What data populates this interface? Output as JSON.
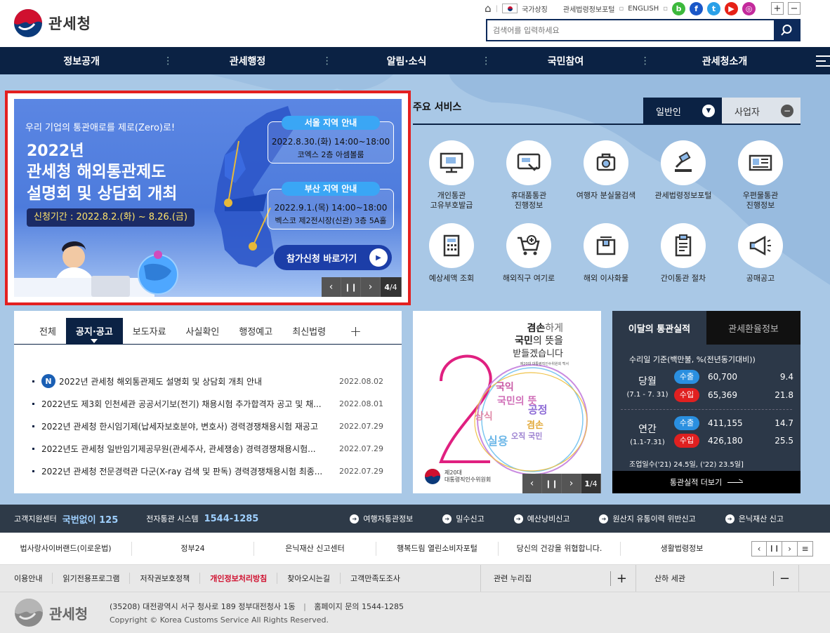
{
  "header": {
    "logo_text": "관세청",
    "util": {
      "home": "home-icon",
      "flag_label": "국가상징",
      "portal_label": "관세법령정보포털",
      "english_label": "ENGLISH",
      "sns": [
        "blog",
        "facebook",
        "twitter",
        "youtube",
        "instagram"
      ],
      "zoom_in": "+",
      "zoom_out": "−"
    },
    "search_placeholder": "검색어를 입력하세요"
  },
  "gnb": [
    "정보공개",
    "관세행정",
    "알림·소식",
    "국민참여",
    "관세청소개"
  ],
  "banner": {
    "tagline": "우리 기업의 통관애로를 제로(Zero)로!",
    "year": "2022년",
    "title_line1": "관세청 해외통관제도",
    "title_line2": "설명회 및 상담회 개최",
    "period": "신청기간 : 2022.8.2.(화) ~ 8.26.(금)",
    "seoul_label": "서울 지역 안내",
    "seoul_date": "2022.8.30.(화) 14:00~18:00",
    "seoul_place": "코엑스 2층 아셈볼룸",
    "busan_label": "부산 지역 안내",
    "busan_date": "2022.9.1.(목) 14:00~18:00",
    "busan_place": "벡스코 제2전시장(신관) 3층 5A홀",
    "cta": "참가신청 바로가기",
    "counter_current": "4",
    "counter_total": "/4"
  },
  "services": {
    "title": "주요 서비스",
    "tabs": [
      "일반인",
      "사업자"
    ],
    "items": [
      {
        "label": "개인통관\n고유부호발급",
        "icon": "monitor-icon"
      },
      {
        "label": "휴대품통관\n진행정보",
        "icon": "screen-hand-icon"
      },
      {
        "label": "여행자 분실물검색",
        "icon": "search-bag-icon"
      },
      {
        "label": "관세법령정보포털",
        "icon": "gavel-icon"
      },
      {
        "label": "우편물통관\n진행정보",
        "icon": "mail-icon"
      },
      {
        "label": "예상세액 조회",
        "icon": "calculator-icon"
      },
      {
        "label": "해외직구 여기로",
        "icon": "cart-icon"
      },
      {
        "label": "해외 이사화물",
        "icon": "box-icon"
      },
      {
        "label": "간이통관 절차",
        "icon": "clipboard-icon"
      },
      {
        "label": "공매공고",
        "icon": "megaphone-icon"
      }
    ]
  },
  "notice": {
    "tabs": [
      "전체",
      "공지·공고",
      "보도자료",
      "사실확인",
      "행정예고",
      "최신법령"
    ],
    "more": "+",
    "new_badge": "N",
    "items": [
      {
        "title": "2022년 관세청 해외통관제도 설명회 및 상담회 개최 안내",
        "date": "2022.08.02"
      },
      {
        "title": "2022년도 제3회 인천세관 공공서기보(전기) 채용시험 추가합격자 공고 및 채...",
        "date": "2022.08.01"
      },
      {
        "title": "2022년 관세청 한시임기제(납세자보호분야, 변호사) 경력경쟁채용시험 재공고",
        "date": "2022.07.29"
      },
      {
        "title": "2022년도 관세청 일반임기제공무원(관세주사, 관세쟁송) 경력경쟁채용시험...",
        "date": "2022.07.29"
      },
      {
        "title": "2022년 관세청 전문경력관 다군(X-ray 검색 및 판독) 경력경쟁채용시험 최종...",
        "date": "2022.07.29"
      }
    ]
  },
  "poster": {
    "line1a": "겸손",
    "line1b": "하게",
    "line2a": "국민",
    "line2b": "의 뜻을",
    "line3": "받들겠습니다",
    "small": "제20대 대통령직인수위원회 백서",
    "words": [
      "국익",
      "상식",
      "국민의 뜻",
      "공정",
      "겸손",
      "실용",
      "오직 국민"
    ],
    "org_line1": "제20대",
    "org_line2": "대통령직인수위원회",
    "counter_current": "1",
    "counter_total": "/4"
  },
  "stats": {
    "tabs": [
      "이달의 통관실적",
      "관세환율정보"
    ],
    "basis": "수리일 기준(백만불, %(전년동기대비))",
    "month_label": "당월",
    "month_range": "(7.1 - 7. 31)",
    "year_label": "연간",
    "year_range": "(1.1-7.31)",
    "export_label": "수출",
    "import_label": "수입",
    "month_export": "60,700",
    "month_export_rate": "9.4",
    "month_import": "65,369",
    "month_import_rate": "21.8",
    "year_export": "411,155",
    "year_export_rate": "14.7",
    "year_import": "426,180",
    "year_import_rate": "25.5",
    "workdays": "조업일수('21) 24.5일, ('22) 23.5일]",
    "more": "통관실적 더보기"
  },
  "call": {
    "center_label": "고객지원센터",
    "center_number": "국번없이 125",
    "system_label": "전자통관 시스템",
    "system_number": "1544-1285",
    "links": [
      "여행자통관정보",
      "밀수신고",
      "예산낭비신고",
      "원산지 유통이력 위반신고",
      "은닉재산 신고"
    ]
  },
  "family": [
    "법사랑사이버랜드(이로운법)",
    "정부24",
    "은닉재산 신고센터",
    "행복드림 열린소비자포털",
    "당신의 건강을 위협합니다.",
    "생활법령정보"
  ],
  "policy": {
    "links": [
      "이용안내",
      "읽기전용프로그램",
      "저작권보호정책",
      "개인정보처리방침",
      "찾아오시는길",
      "고객만족도조사"
    ],
    "related": "관련 누리집",
    "related_btn": "+",
    "customs": "산하 세관",
    "customs_btn": "−"
  },
  "footer": {
    "logo_text": "관세청",
    "address": "(35208) 대전광역시 서구 청사로 189 정부대전청사 1동",
    "inquiry": "홈페이지 문의 1544-1285",
    "copyright": "Copyright © Korea Customs Service All Rights Reserved."
  },
  "colors": {
    "navy": "#0b2244",
    "banner_red_border": "#e32020",
    "export_blue": "#2a8fe0",
    "import_red": "#e02020",
    "policy_red": "#d0102f"
  }
}
